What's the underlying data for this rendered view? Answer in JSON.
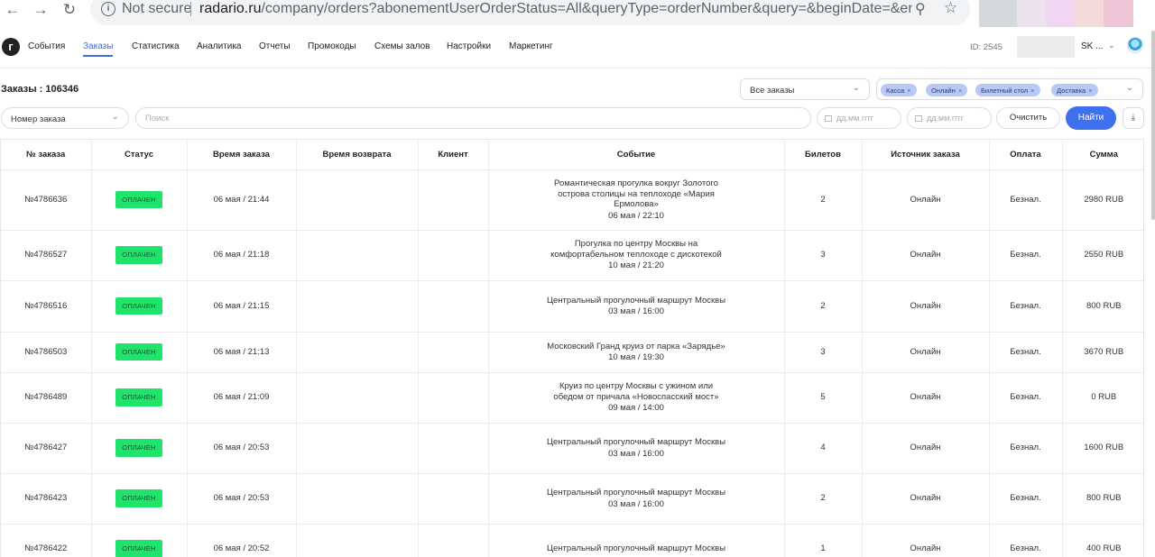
{
  "browser": {
    "security": "Not secure",
    "url_host": "radario.ru",
    "url_path": "/company/orders?abonementUserOrderStatus=All&queryType=orderNumber&query=&beginDate=&endDate=..."
  },
  "nav": {
    "items": [
      "События",
      "Заказы",
      "Статистика",
      "Аналитика",
      "Отчеты",
      "Промокоды",
      "Схемы залов",
      "Настройки",
      "Маркетинг"
    ],
    "active": "Заказы",
    "account_id": "ID: 2545",
    "account_name": "SK ..."
  },
  "page": {
    "orders_count": "Заказы : 106346",
    "orders_filter": "Все заказы",
    "tags": [
      "Касса",
      "Онлайн",
      "Билетный стол",
      "Доставка"
    ],
    "query_type": "Номер заказа",
    "search_placeholder": "Поиск",
    "date_from_placeholder": "дд.мм.гггг",
    "date_to_placeholder": "дд.мм.гггг",
    "clear_label": "Очистить",
    "find_label": "Найти"
  },
  "table": {
    "headers": [
      "№ заказа",
      "Статус",
      "Время заказа",
      "Время возврата",
      "Клиент",
      "Событие",
      "Билетов",
      "Источник заказа",
      "Оплата",
      "Сумма"
    ],
    "rows": [
      {
        "num": "№4786636",
        "status": "ОПЛАЧЕН",
        "time": "06 мая / 21:44",
        "return": "",
        "client": "",
        "event": "Романтическая прогулка вокруг Золотого острова столицы на теплоходе «Мария Ермолова»",
        "event_date": "06 мая / 22:10",
        "tickets": "2",
        "source": "Онлайн",
        "payment": "Безнал.",
        "sum": "2980 RUB"
      },
      {
        "num": "№4786527",
        "status": "ОПЛАЧЕН",
        "time": "06 мая / 21:18",
        "return": "",
        "client": "",
        "event": "Прогулка по центру Москвы на комфортабельном теплоходе с дискотекой",
        "event_date": "10 мая / 21:20",
        "tickets": "3",
        "source": "Онлайн",
        "payment": "Безнал.",
        "sum": "2550 RUB"
      },
      {
        "num": "№4786516",
        "status": "ОПЛАЧЕН",
        "time": "06 мая / 21:15",
        "return": "",
        "client": "",
        "event": "Центральный прогулочный маршрут Москвы",
        "event_date": "03 мая / 16:00",
        "tickets": "2",
        "source": "Онлайн",
        "payment": "Безнал.",
        "sum": "800 RUB"
      },
      {
        "num": "№4786503",
        "status": "ОПЛАЧЕН",
        "time": "06 мая / 21:13",
        "return": "",
        "client": "",
        "event": "Московский Гранд круиз от парка «Зарядье»",
        "event_date": "10 мая / 19:30",
        "tickets": "3",
        "source": "Онлайн",
        "payment": "Безнал.",
        "sum": "3670 RUB"
      },
      {
        "num": "№4786489",
        "status": "ОПЛАЧЕН",
        "time": "06 мая / 21:09",
        "return": "",
        "client": "",
        "event": "Круиз по центру Москвы с ужином или обедом от причала «Новоспасский мост»",
        "event_date": "09 мая / 14:00",
        "tickets": "5",
        "source": "Онлайн",
        "payment": "Безнал.",
        "sum": "0 RUB"
      },
      {
        "num": "№4786427",
        "status": "ОПЛАЧЕН",
        "time": "06 мая / 20:53",
        "return": "",
        "client": "",
        "event": "Центральный прогулочный маршрут Москвы",
        "event_date": "03 мая / 16:00",
        "tickets": "4",
        "source": "Онлайн",
        "payment": "Безнал.",
        "sum": "1600 RUB"
      },
      {
        "num": "№4786423",
        "status": "ОПЛАЧЕН",
        "time": "06 мая / 20:53",
        "return": "",
        "client": "",
        "event": "Центральный прогулочный маршрут Москвы",
        "event_date": "03 мая / 16:00",
        "tickets": "2",
        "source": "Онлайн",
        "payment": "Безнал.",
        "sum": "800 RUB"
      },
      {
        "num": "№4786422",
        "status": "ОПЛАЧЕН",
        "time": "06 мая / 20:52",
        "return": "",
        "client": "",
        "event": "Центральный прогулочный маршрут Москвы",
        "event_date": "",
        "tickets": "1",
        "source": "Онлайн",
        "payment": "Безнал.",
        "sum": "400 RUB"
      }
    ]
  },
  "colors": {
    "accent": "#3f70f0",
    "paid_badge": "#1fe36a",
    "tag_bg": "#b9c8f5"
  }
}
